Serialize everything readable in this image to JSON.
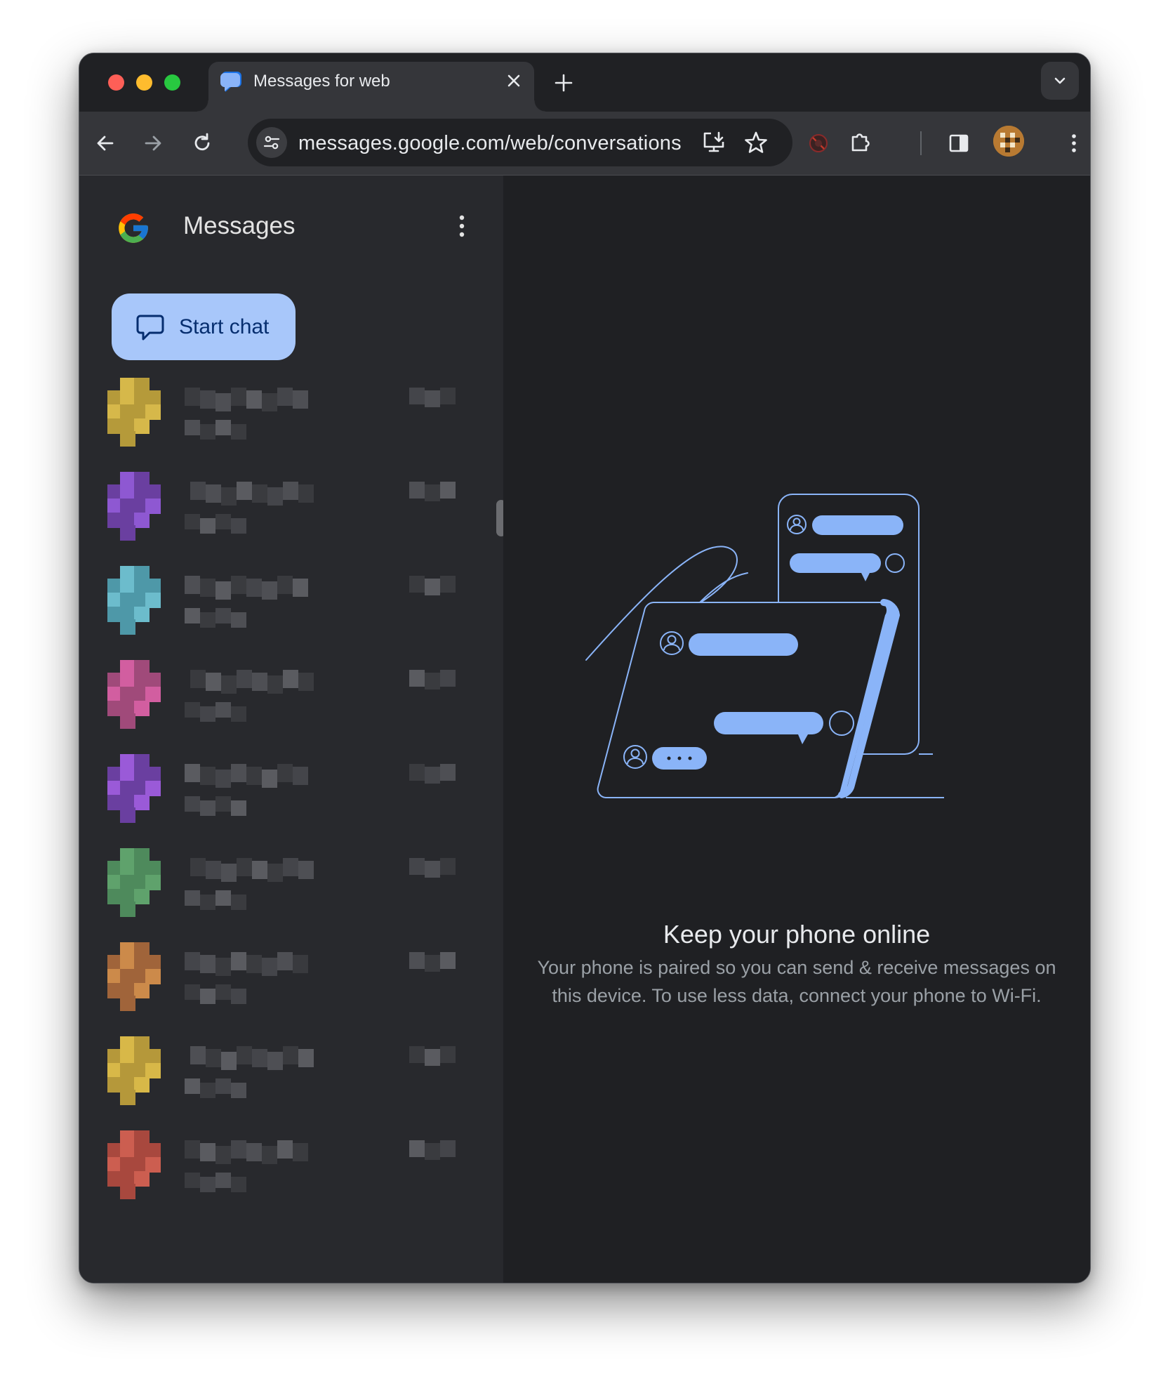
{
  "browser": {
    "tab": {
      "title": "Messages for web"
    },
    "address_bar": {
      "url": "messages.google.com/web/conversations"
    }
  },
  "app": {
    "title": "Messages",
    "start_chat_label": "Start chat",
    "conversation_count_visible": 9
  },
  "empty_state": {
    "title": "Keep your phone online",
    "description": "Your phone is paired so you can send & receive messages on this device. To use less data, connect your phone to Wi-Fi."
  },
  "colors": {
    "accent": "#a8c7fa",
    "illustration_blue": "#8ab4f8",
    "sidebar_bg": "#28292d",
    "main_bg": "#1f2023"
  },
  "conversations": [
    {
      "avatar_color": "#b59a3a",
      "avatar_color_2": "#d6b84a"
    },
    {
      "avatar_color": "#6a3fa0",
      "avatar_color_2": "#8e58d2"
    },
    {
      "avatar_color": "#4e98a8",
      "avatar_color_2": "#6cbccc"
    },
    {
      "avatar_color": "#a04a7a",
      "avatar_color_2": "#d25ea0"
    },
    {
      "avatar_color": "#6a3fa0",
      "avatar_color_2": "#9a5ad8"
    },
    {
      "avatar_color": "#4e8a5c",
      "avatar_color_2": "#5fa26c"
    },
    {
      "avatar_color": "#a0643a",
      "avatar_color_2": "#cc8a4a"
    },
    {
      "avatar_color": "#b5983a",
      "avatar_color_2": "#d8b848"
    },
    {
      "avatar_color": "#a8483e",
      "avatar_color_2": "#cc5e50"
    }
  ]
}
